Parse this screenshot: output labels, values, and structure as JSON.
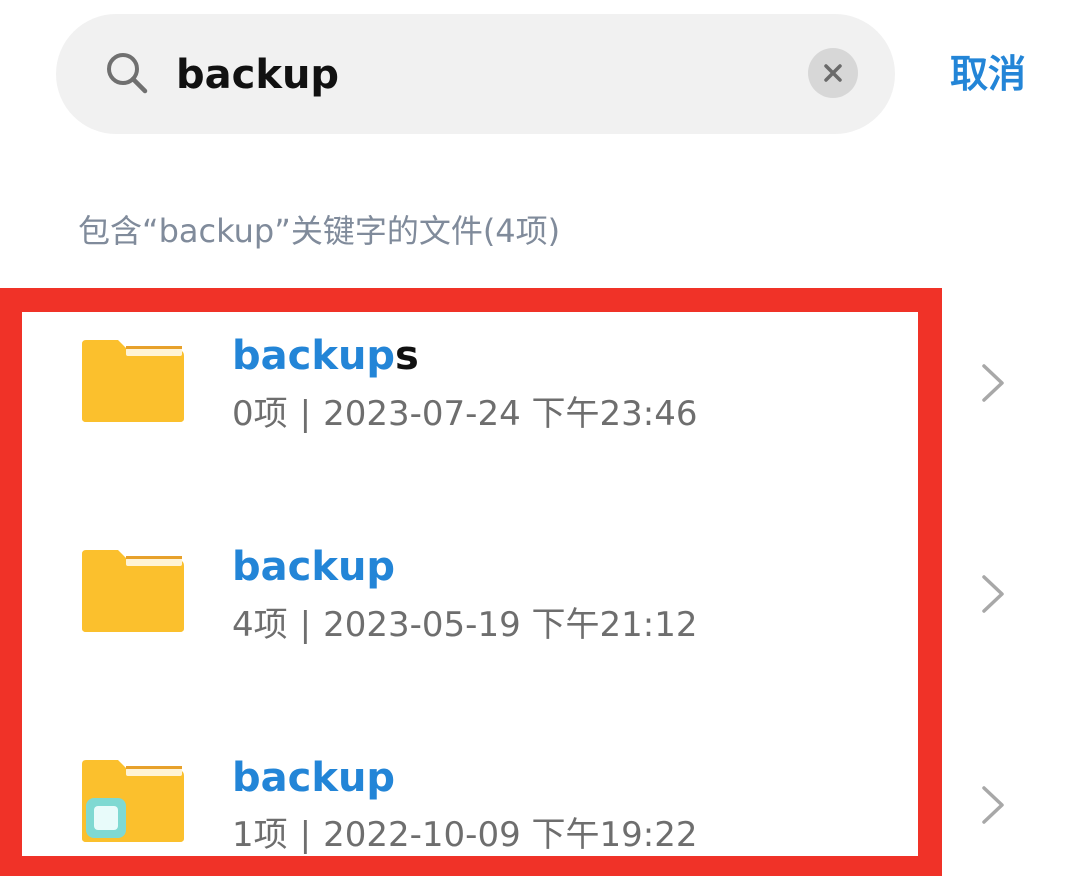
{
  "search": {
    "query": "backup",
    "cancel_label": "取消"
  },
  "results": {
    "header": "包含“backup”关键字的文件(4项)",
    "items": [
      {
        "name_match": "backup",
        "name_rest": "s",
        "count": "0项",
        "separator": "|",
        "datetime": "2023-07-24 下午23:46",
        "icon": "folder-icon"
      },
      {
        "name_match": "backup",
        "name_rest": "",
        "count": "4项",
        "separator": "|",
        "datetime": "2023-05-19 下午21:12",
        "icon": "folder-icon"
      },
      {
        "name_match": "backup",
        "name_rest": "",
        "count": "1项",
        "separator": "|",
        "datetime": "2022-10-09 下午19:22",
        "icon": "folder-with-app-badge-icon"
      }
    ]
  },
  "colors": {
    "accent": "#2385d7",
    "highlight": "#f03228",
    "folder": "#fbc02d"
  }
}
